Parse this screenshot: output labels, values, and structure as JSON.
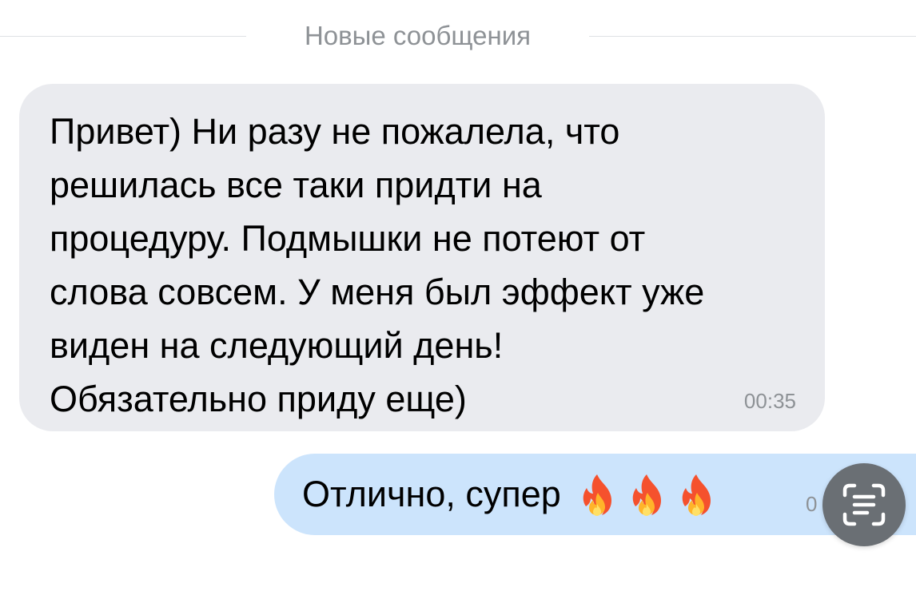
{
  "divider": {
    "label": "Новые сообщения"
  },
  "incoming_message": {
    "text": "Привет) Ни разу не пожалела, что\nрешилась все таки придти на\nпроцедуру. Подмышки не потеют от\nслова совсем. У меня был эффект уже\nвиден на следующий день!\nОбязательно приду еще)",
    "time": "00:35"
  },
  "outgoing_message": {
    "text": "Отлично, супер",
    "emojis": [
      "fire-icon",
      "fire-icon",
      "fire-icon"
    ],
    "time_partial": "0"
  },
  "scan_button": {
    "icon": "text-scan-icon"
  },
  "colors": {
    "incoming_bubble": "#eaebef",
    "outgoing_bubble": "#cce4fc",
    "muted_text": "#8e9296",
    "scan_button": "#6a6f74"
  }
}
